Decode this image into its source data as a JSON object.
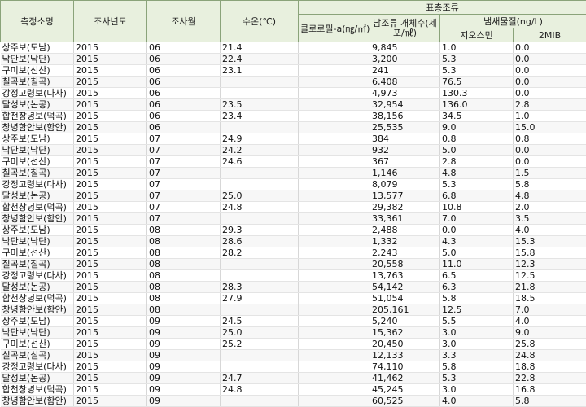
{
  "headers": {
    "site": "측정소명",
    "year": "조사년도",
    "month": "조사월",
    "water_temp": "수온(℃)",
    "surface_algae": "표층조류",
    "chlorophyll": "클로로필-a(㎎/㎥)",
    "bluegreen_count": "남조류 개체수(세포/㎖)",
    "odor": "냄새물질(ng/L)",
    "geosmin": "지오스민",
    "mib": "2MIB"
  },
  "rows": [
    [
      "상주보(도남)",
      "2015",
      "06",
      "21.4",
      "",
      "9,845",
      "1.0",
      "0.0"
    ],
    [
      "낙단보(낙단)",
      "2015",
      "06",
      "22.4",
      "",
      "3,200",
      "5.3",
      "0.0"
    ],
    [
      "구미보(선산)",
      "2015",
      "06",
      "23.1",
      "",
      "241",
      "5.3",
      "0.0"
    ],
    [
      "칠곡보(칠곡)",
      "2015",
      "06",
      "",
      "",
      "6,408",
      "76.5",
      "0.0"
    ],
    [
      "강정고령보(다사)",
      "2015",
      "06",
      "",
      "",
      "4,973",
      "130.3",
      "0.0"
    ],
    [
      "달성보(논공)",
      "2015",
      "06",
      "23.5",
      "",
      "32,954",
      "136.0",
      "2.8"
    ],
    [
      "합천창녕보(덕곡)",
      "2015",
      "06",
      "23.4",
      "",
      "38,156",
      "34.5",
      "1.0"
    ],
    [
      "창녕함안보(함안)",
      "2015",
      "06",
      "",
      "",
      "25,535",
      "9.0",
      "15.0"
    ],
    [
      "상주보(도남)",
      "2015",
      "07",
      "24.9",
      "",
      "384",
      "0.8",
      "0.8"
    ],
    [
      "낙단보(낙단)",
      "2015",
      "07",
      "24.2",
      "",
      "932",
      "5.0",
      "0.0"
    ],
    [
      "구미보(선산)",
      "2015",
      "07",
      "24.6",
      "",
      "367",
      "2.8",
      "0.0"
    ],
    [
      "칠곡보(칠곡)",
      "2015",
      "07",
      "",
      "",
      "1,146",
      "4.8",
      "1.5"
    ],
    [
      "강정고령보(다사)",
      "2015",
      "07",
      "",
      "",
      "8,079",
      "5.3",
      "5.8"
    ],
    [
      "달성보(논공)",
      "2015",
      "07",
      "25.0",
      "",
      "13,577",
      "6.8",
      "4.8"
    ],
    [
      "합천창녕보(덕곡)",
      "2015",
      "07",
      "24.8",
      "",
      "29,382",
      "10.8",
      "2.0"
    ],
    [
      "창녕함안보(함안)",
      "2015",
      "07",
      "",
      "",
      "33,361",
      "7.0",
      "3.5"
    ],
    [
      "상주보(도남)",
      "2015",
      "08",
      "29.3",
      "",
      "2,488",
      "0.0",
      "4.0"
    ],
    [
      "낙단보(낙단)",
      "2015",
      "08",
      "28.6",
      "",
      "1,332",
      "4.3",
      "15.3"
    ],
    [
      "구미보(선산)",
      "2015",
      "08",
      "28.2",
      "",
      "2,243",
      "5.0",
      "15.8"
    ],
    [
      "칠곡보(칠곡)",
      "2015",
      "08",
      "",
      "",
      "20,558",
      "11.0",
      "12.3"
    ],
    [
      "강정고령보(다사)",
      "2015",
      "08",
      "",
      "",
      "13,763",
      "6.5",
      "12.5"
    ],
    [
      "달성보(논공)",
      "2015",
      "08",
      "28.3",
      "",
      "54,142",
      "6.3",
      "21.8"
    ],
    [
      "합천창녕보(덕곡)",
      "2015",
      "08",
      "27.9",
      "",
      "51,054",
      "5.8",
      "18.5"
    ],
    [
      "창녕함안보(함안)",
      "2015",
      "08",
      "",
      "",
      "205,161",
      "12.5",
      "7.0"
    ],
    [
      "상주보(도남)",
      "2015",
      "09",
      "24.5",
      "",
      "5,240",
      "5.5",
      "4.0"
    ],
    [
      "낙단보(낙단)",
      "2015",
      "09",
      "25.0",
      "",
      "15,362",
      "3.0",
      "9.0"
    ],
    [
      "구미보(선산)",
      "2015",
      "09",
      "25.2",
      "",
      "20,450",
      "3.0",
      "25.8"
    ],
    [
      "칠곡보(칠곡)",
      "2015",
      "09",
      "",
      "",
      "12,133",
      "3.3",
      "24.8"
    ],
    [
      "강정고령보(다사)",
      "2015",
      "09",
      "",
      "",
      "74,110",
      "5.8",
      "18.8"
    ],
    [
      "달성보(논공)",
      "2015",
      "09",
      "24.7",
      "",
      "41,462",
      "5.3",
      "22.8"
    ],
    [
      "합천창녕보(덕곡)",
      "2015",
      "09",
      "24.8",
      "",
      "45,245",
      "3.0",
      "16.8"
    ],
    [
      "창녕함안보(함안)",
      "2015",
      "09",
      "",
      "",
      "60,525",
      "4.0",
      "5.8"
    ]
  ]
}
